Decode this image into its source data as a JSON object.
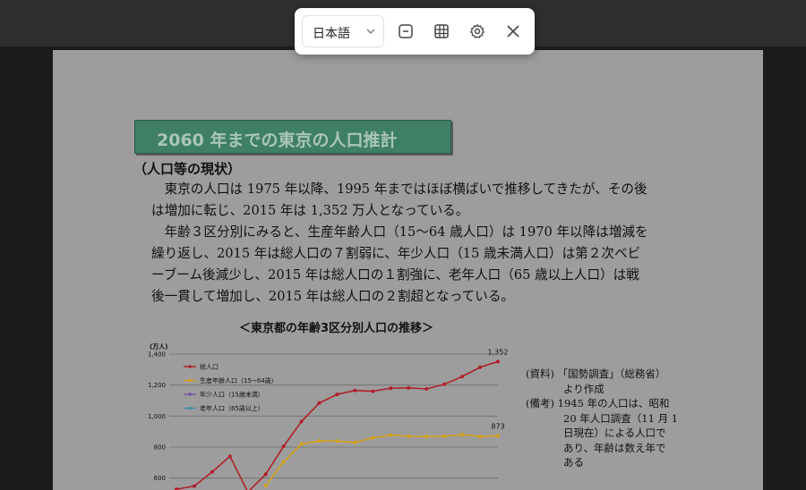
{
  "toolbar": {
    "language": "日本語",
    "icons": [
      "chevron-down-icon",
      "minus-square-icon",
      "grid-icon",
      "gear-icon",
      "close-icon"
    ]
  },
  "document": {
    "banner_title": "2060 年までの東京の人口推計",
    "section_heading": "（人口等の現状）",
    "paragraph1_lines": [
      "　東京の人口は 1975 年以降、1995 年まではほぼ横ばいで推移してきたが、その後",
      "は増加に転じ、2015 年は 1,352 万人となっている。"
    ],
    "paragraph2_lines": [
      "　年齢３区分別にみると、生産年齢人口（15～64 歳人口）は 1970 年以降は増減を",
      "繰り返し、2015 年は総人口の７割弱に、年少人口（15 歳未満人口）は第２次ベビ",
      "ーブーム後減少し、2015 年は総人口の１割強に、老年人口（65 歳以上人口）は戦",
      "後一貫して増加し、2015 年は総人口の２割超となっている。"
    ],
    "chart_title": "＜東京都の年齢3区分別人口の推移＞",
    "notes": {
      "source_label": "(資料)",
      "source_text": "「国勢調査」（総務省）",
      "source_text2": "より作成",
      "remark_label": "(備考)",
      "remark_lines": [
        "1945 年の人口は、昭和",
        "20 年人口調査（11 月 1",
        "日現在）による人口で",
        "あり、年齢は数え年で",
        "ある"
      ]
    }
  },
  "chart_data": {
    "type": "line",
    "ylabel": "(万人)",
    "ylim": [
      500,
      1400
    ],
    "yticks": [
      "1,400",
      "1,200",
      "1,000",
      "800",
      "600"
    ],
    "ytick_values": [
      1400,
      1200,
      1000,
      800,
      600
    ],
    "grid": true,
    "legend_position": "top-left",
    "series": [
      {
        "name": "総人口",
        "color": "#b0202a",
        "values": [
          528,
          548,
          640,
          740,
          510,
          625,
          805,
          965,
          1085,
          1140,
          1165,
          1160,
          1180,
          1182,
          1175,
          1205,
          1255,
          1315,
          1352
        ]
      },
      {
        "name": "生産年齢人口（15~64歳）",
        "color": "#d6a21a",
        "values": [
          null,
          null,
          null,
          null,
          null,
          550,
          705,
          820,
          840,
          838,
          830,
          860,
          878,
          870,
          868,
          870,
          880,
          868,
          873
        ]
      },
      {
        "name": "年少人口（15歳未満）",
        "color": "#7b4fa8",
        "values": []
      },
      {
        "name": "老年人口（65歳以上）",
        "color": "#3f8fa8",
        "values": []
      }
    ],
    "data_labels": [
      {
        "series": "総人口",
        "text": "1,352"
      },
      {
        "series": "生産年齢人口（15~64歳）",
        "text": "873"
      }
    ]
  }
}
